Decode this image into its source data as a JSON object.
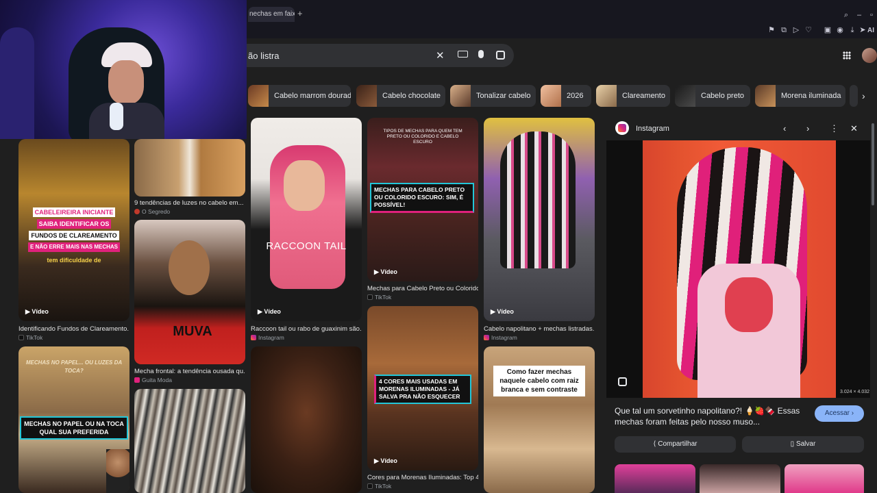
{
  "browser": {
    "active_tab_title": "nechas em faixa co",
    "new_tab_symbol": "+",
    "ai_label": "AI"
  },
  "search": {
    "query": "ão listra",
    "icons": [
      "clear-icon",
      "keyboard-icon",
      "mic-icon",
      "lens-icon"
    ]
  },
  "chips": [
    {
      "label": "Cabelo marrom dourado"
    },
    {
      "label": "Cabelo chocolate"
    },
    {
      "label": "Tonalizar cabelo"
    },
    {
      "label": "2026"
    },
    {
      "label": "Clareamento"
    },
    {
      "label": "Cabelo preto"
    },
    {
      "label": "Morena iluminada"
    }
  ],
  "grid": {
    "video_label": "Vídeo",
    "items": [
      {
        "title": "Identificando Fundos de Clareamento...",
        "source": "TikTok",
        "overlay": [
          "CABELEIREIRA INICIANTE",
          "SAIBA IDENTIFICAR OS",
          "FUNDOS DE CLAREAMENTO",
          "E NÃO ERRE MAIS NAS MECHAS",
          "tem dificuldade de"
        ]
      },
      {
        "title": "9 tendências de luzes no cabelo em...",
        "source": "O Segredo"
      },
      {
        "title": "Mecha frontal: a tendência ousada qu...",
        "source": "Guita Moda",
        "overlay": [
          "MUVA"
        ]
      },
      {
        "title": "Raccoon tail ou rabo de guaxinim são...",
        "source": "Instagram",
        "overlay": [
          "RACCOON TAIL"
        ]
      },
      {
        "title": "Mechas para Cabelo Preto ou Colorido...",
        "source": "TikTok",
        "overlay": [
          "TIPOS DE MECHAS PARA QUEM TEM PRETO OU COLORIDO E CABELO ESCURO",
          "MECHAS PARA CABELO PRETO OU COLORIDO ESCURO: SIM, É POSSÍVEL!"
        ]
      },
      {
        "title": "Cabelo napolitano + mechas listradas...",
        "source": "Instagram"
      },
      {
        "title": "",
        "source": "",
        "overlay": [
          "MECHAS NO PAPEL OU NA TOCA",
          "QUAL SUA PREFERIDA",
          "MECHAS NO PAPEL... OU LUZES DA TOCA?"
        ]
      },
      {
        "title": "Cores para Morenas Iluminadas: Top 4...",
        "source": "TikTok",
        "overlay": [
          "4 CORES MAIS USADAS EM MORENAS ILUMINADAS - JÁ SALVA PRA NÃO ESQUECER"
        ]
      },
      {
        "title": "",
        "source": "",
        "overlay": [
          "Como fazer mechas naquele cabelo com raiz branca e sem contraste"
        ]
      }
    ]
  },
  "panel": {
    "source": "Instagram",
    "dimensions": "3.024 × 4.032",
    "description": "Que tal um sorvetinho napolitano?! 🍦🍓🍫 Essas mechas foram feitas pelo nosso muso...",
    "visit_label": "Acessar",
    "share_label": "Compartilhar",
    "save_label": "Salvar"
  },
  "colors": {
    "background": "#1f1f1f",
    "chip": "#303134",
    "accent": "#8ab4f8",
    "overlay_teal": "#22c7d9",
    "overlay_pink": "#e0217c"
  }
}
